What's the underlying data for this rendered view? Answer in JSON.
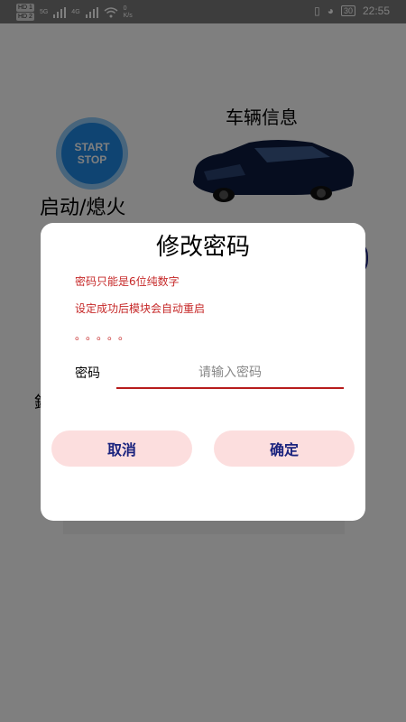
{
  "statusbar": {
    "sim1": "HD 1",
    "sim2": "HD 2",
    "net1": "5G",
    "net2": "4G",
    "speed": "0\nK/s",
    "battery": "30",
    "time": "22:55"
  },
  "page": {
    "start_button_line1": "START",
    "start_button_line2": "STOP",
    "start_label": "启动/熄火",
    "vehicle_title": "车辆信息",
    "side_letter": "鉬"
  },
  "dialog": {
    "title": "修改密码",
    "note1": "密码只能是6位纯数字",
    "note2": "设定成功后模块会自动重启",
    "dots": "。。。。。",
    "password_label": "密码",
    "password_placeholder": "请输入密码",
    "cancel_label": "取消",
    "confirm_label": "确定"
  }
}
